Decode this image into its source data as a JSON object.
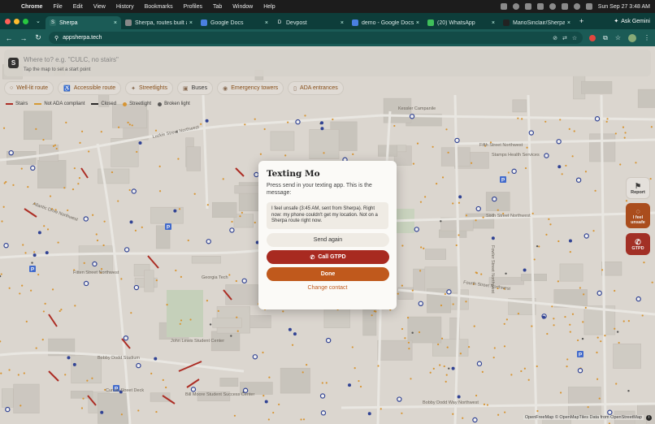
{
  "menubar": {
    "app": "Chrome",
    "items": [
      "File",
      "Edit",
      "View",
      "History",
      "Bookmarks",
      "Profiles",
      "Tab",
      "Window",
      "Help"
    ],
    "clock": "Sun Sep 27  3:48 AM"
  },
  "tabs": [
    {
      "label": "Sherpa",
      "active": true,
      "fav": "S",
      "fav_color": "#2b6b64"
    },
    {
      "label": "Sherpa, routes built a",
      "active": false,
      "fav": "",
      "fav_color": "#888888"
    },
    {
      "label": "Google Docs",
      "active": false,
      "fav": "",
      "fav_color": "#4a7fe0"
    },
    {
      "label": "Devpost",
      "active": false,
      "fav": "D",
      "fav_color": "#0d3d3a"
    },
    {
      "label": "demo - Google Docs",
      "active": false,
      "fav": "",
      "fav_color": "#4a7fe0"
    },
    {
      "label": "(20) WhatsApp",
      "active": false,
      "fav": "",
      "fav_color": "#3fbf5a"
    },
    {
      "label": "MarioSinclair/Sherpa",
      "active": false,
      "fav": "",
      "fav_color": "#222222"
    }
  ],
  "ask_gemini": "Ask Gemini",
  "address": {
    "url": "appsherpa.tech"
  },
  "search": {
    "placeholder": "Where to? e.g. \"CULC, no stairs\"",
    "hint": "Tap the map to set a start point"
  },
  "chips": [
    {
      "label": "Well-lit route",
      "icon": "bulb-icon"
    },
    {
      "label": "Accessible route",
      "icon": "wheelchair-icon"
    },
    {
      "label": "Streetlights",
      "icon": "streetlight-icon"
    },
    {
      "label": "Buses",
      "icon": "bus-icon"
    },
    {
      "label": "Emergency towers",
      "icon": "tower-icon"
    },
    {
      "label": "ADA entrances",
      "icon": "door-icon"
    }
  ],
  "legend": [
    {
      "label": "Stairs",
      "color": "#b3261e",
      "kind": "line"
    },
    {
      "label": "Not ADA compliant",
      "color": "#e0a030",
      "kind": "line"
    },
    {
      "label": "Closed",
      "color": "#222222",
      "kind": "line"
    },
    {
      "label": "Streetlight",
      "color": "#e39a2e",
      "kind": "dot"
    },
    {
      "label": "Broken light",
      "color": "#555555",
      "kind": "dot"
    }
  ],
  "side_buttons": {
    "report": "Report",
    "unsafe": "I feel unsafe",
    "gtpd": "GTPD"
  },
  "dialog": {
    "title": "Texting Mo",
    "instructions": "Press send in your texting app. This is the message:",
    "message": "I feel unsafe (3:45 AM, sent from Sherpa). Right now: my phone couldn't get my location. Not on a Sherpa route right now.",
    "send_again": "Send again",
    "call": "Call GTPD",
    "done": "Done",
    "change": "Change contact"
  },
  "map_labels": [
    "Luckie Street Northwest",
    "Georgia Tech",
    "John Lewis Student Center",
    "Curran Street Deck",
    "Kessler Campanile",
    "Atlantic Drive Northwest",
    "Ferst Drive Northwest",
    "State Street Northwest",
    "Fowler Street Northwest",
    "Fourth Street Northwest",
    "Bobby Dodd Way Northwest",
    "Fifth Street Northwest",
    "Sixth Street Northwest",
    "Fitten Street Northwest",
    "Stamps Health Services",
    "Bill Moore Student Success Center",
    "Bobby Dodd Stadium"
  ],
  "attribution": "OpenFreeMap © OpenMapTiles Data from OpenStreetMap",
  "colors": {
    "accent": "#a82a20",
    "brand": "#c0591c",
    "chrome_tab": "#0d3d3a",
    "map_bg": "#e7e3dc"
  }
}
